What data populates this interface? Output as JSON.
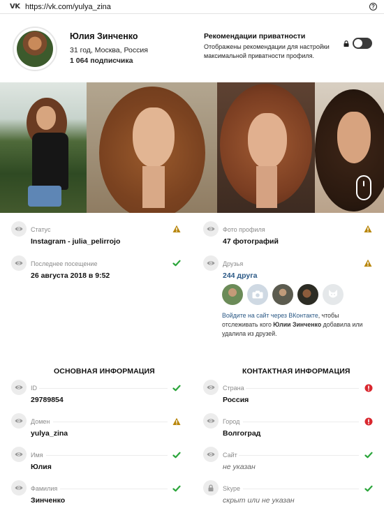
{
  "urlbar": {
    "logo": "VK",
    "url": "https://vk.com/yulya_zina",
    "help_icon": "?"
  },
  "profile": {
    "name": "Юлия Зинченко",
    "info": "31 год, Москва, Россия",
    "subscribers": "1 064 подписчика"
  },
  "privacy": {
    "title": "Рекомендации приватности",
    "desc": "Отображены рекомендации для настройки максимальной приватности профиля.",
    "toggle_on": false
  },
  "left_items": [
    {
      "label": "Статус",
      "value": "Instagram - julia_pelirrojo",
      "status": "warning"
    },
    {
      "label": "Последнее посещение",
      "value": "26 августа 2018 в 9:52",
      "status": "ok"
    }
  ],
  "right_items": [
    {
      "label": "Фото профиля",
      "value": "47 фотографий",
      "status": "warning"
    },
    {
      "label": "Друзья",
      "value": "244 друга",
      "status": "warning"
    }
  ],
  "friends_note": {
    "link": "Войдите на сайт через ВКонтакте",
    "part1": ", чтобы отслеживать кого ",
    "name": "Юлии Зинченко",
    "part2": " добавила или удалила из друзей."
  },
  "basic": {
    "title": "ОСНОВНАЯ ИНФОРМАЦИЯ",
    "items": [
      {
        "label": "ID",
        "value": "29789854",
        "status": "ok"
      },
      {
        "label": "Домен",
        "value": "yulya_zina",
        "status": "warning"
      },
      {
        "label": "Имя",
        "value": "Юлия",
        "status": "ok"
      },
      {
        "label": "Фамилия",
        "value": "Зинченко",
        "status": "ok"
      }
    ]
  },
  "contact": {
    "title": "КОНТАКТНАЯ ИНФОРМАЦИЯ",
    "items": [
      {
        "label": "Страна",
        "value": "Россия",
        "status": "error"
      },
      {
        "label": "Город",
        "value": "Волгоград",
        "status": "error"
      },
      {
        "label": "Сайт",
        "value": "не указан",
        "status": "ok"
      },
      {
        "label": "Skype",
        "value": "скрыт или не указан",
        "status": "ok"
      }
    ]
  },
  "colors": {
    "ok": "#2aa53a",
    "warning": "#b8860b",
    "error": "#d9282f",
    "link": "#2a5885"
  }
}
